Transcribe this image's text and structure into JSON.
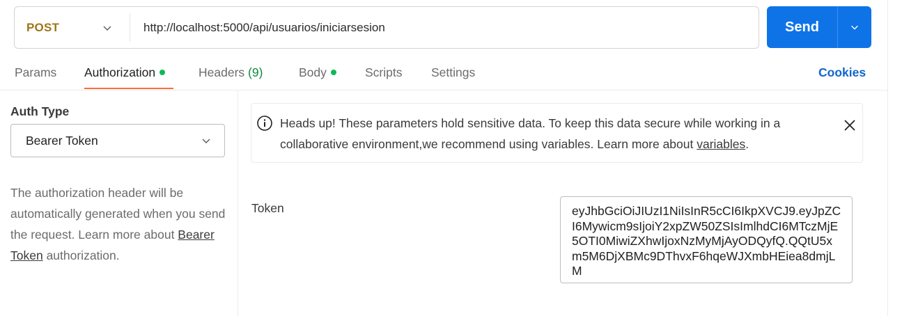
{
  "request": {
    "method": "POST",
    "url": "http://localhost:5000/api/usuarios/iniciarsesion",
    "send_label": "Send"
  },
  "tabs": [
    {
      "label": "Params"
    },
    {
      "label": "Authorization"
    },
    {
      "label": "Headers",
      "count": "(9)"
    },
    {
      "label": "Body"
    },
    {
      "label": "Scripts"
    },
    {
      "label": "Settings"
    }
  ],
  "cookies_label": "Cookies",
  "auth": {
    "type_label": "Auth Type",
    "selected": "Bearer Token",
    "help_before": "The authorization header will be automatically generated when you send the request. Learn more about ",
    "help_link": "Bearer Token",
    "help_after": " authorization."
  },
  "alert": {
    "text": "Heads up! These parameters hold sensitive data. To keep this data secure while working in a collaborative environment,we recommend using variables. Learn more about ",
    "link": "variables",
    "end": "."
  },
  "token": {
    "label": "Token",
    "value": "eyJhbGciOiJIUzI1NiIsInR5cCI6IkpXVCJ9.eyJpZCI6Mywicm9sIjoiY2xpZW50ZSIsImlhdCI6MTczMjE5OTI0MiwiZXhwIjoxNzMyMjAyODQyfQ.QQtU5xm5M6DjXBMc9DThvxF6hqeWJXmbHEiea8dmjLM"
  },
  "colors": {
    "method": "#a07518",
    "send": "#0f73e8",
    "active_tab_underline": "#ff6c37",
    "status_dot": "#0cbb52",
    "cookies": "#1166cc"
  }
}
